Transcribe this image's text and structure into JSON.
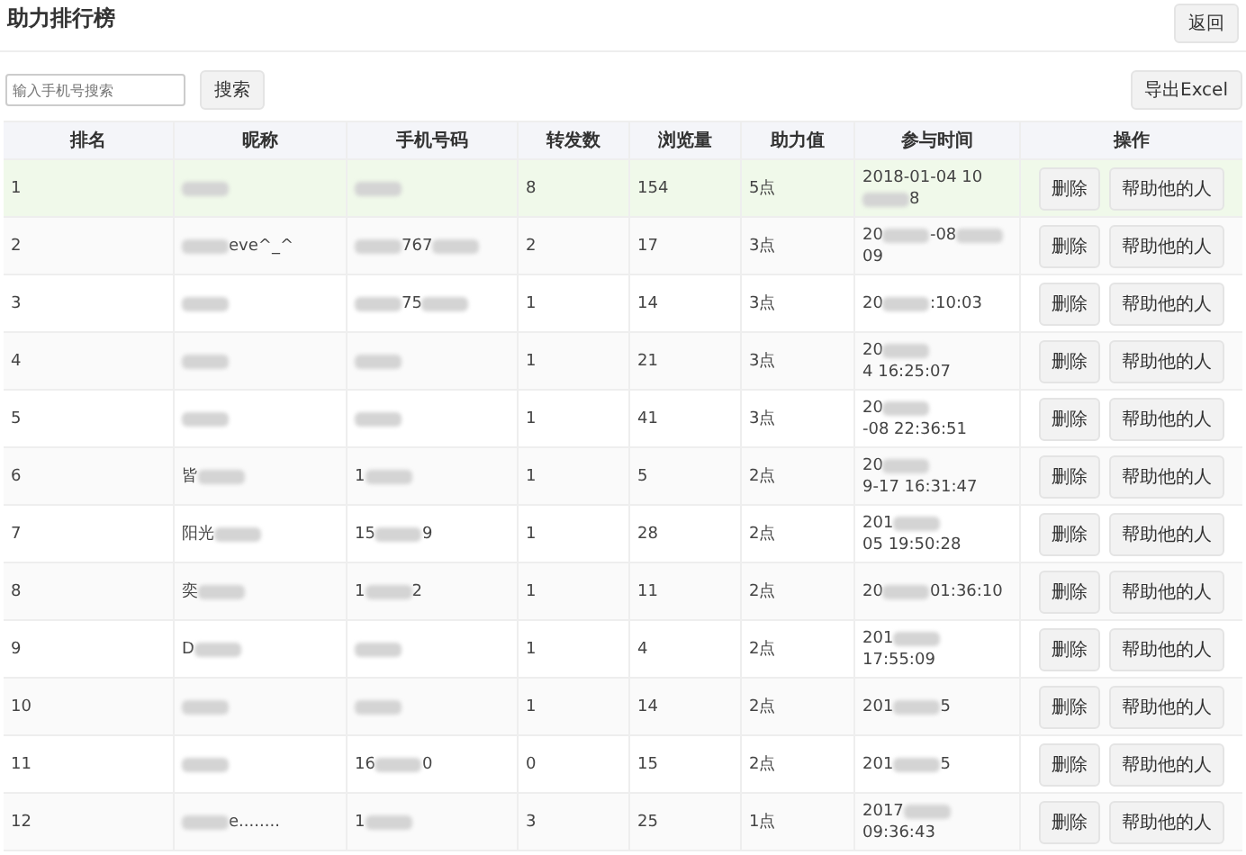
{
  "page": {
    "title": "助力排行榜",
    "back_button": "返回"
  },
  "toolbar": {
    "search": {
      "placeholder": "输入手机号搜索"
    },
    "search_button": "搜索",
    "export_button": "导出Excel"
  },
  "table": {
    "columns": [
      "排名",
      "昵称",
      "手机号码",
      "转发数",
      "浏览量",
      "助力值",
      "参与时间",
      "操作"
    ],
    "rows": [
      {
        "selected": true,
        "rank": "1",
        "actions": [
          "删除",
          "帮助他的人"
        ],
        "nickname": [
          {
            "kind": "blur"
          }
        ],
        "phone": [
          {
            "kind": "blur"
          }
        ],
        "shares": "8",
        "views": "154",
        "points": "5点",
        "time": [
          {
            "kind": "text",
            "text": "2018-01-04 10"
          },
          {
            "kind": "blur"
          },
          {
            "kind": "text",
            "text": "8"
          }
        ]
      },
      {
        "selected": false,
        "rank": "2",
        "actions": [
          "删除",
          "帮助他的人"
        ],
        "nickname": [
          {
            "kind": "blur"
          },
          {
            "kind": "text",
            "text": "eve^_^"
          }
        ],
        "phone": [
          {
            "kind": "blur"
          },
          {
            "kind": "text",
            "text": "767"
          },
          {
            "kind": "blur"
          }
        ],
        "shares": "2",
        "views": "17",
        "points": "3点",
        "time": [
          {
            "kind": "text",
            "text": "20"
          },
          {
            "kind": "blur"
          },
          {
            "kind": "text",
            "text": "-08"
          },
          {
            "kind": "blur"
          },
          {
            "kind": "text",
            "text": "09"
          }
        ]
      },
      {
        "selected": false,
        "rank": "3",
        "actions": [
          "删除",
          "帮助他的人"
        ],
        "nickname": [
          {
            "kind": "blur"
          }
        ],
        "phone": [
          {
            "kind": "blur"
          },
          {
            "kind": "text",
            "text": "75"
          },
          {
            "kind": "blur"
          }
        ],
        "shares": "1",
        "views": "14",
        "points": "3点",
        "time": [
          {
            "kind": "text",
            "text": "20"
          },
          {
            "kind": "blur"
          },
          {
            "kind": "text",
            "text": ":10:03"
          }
        ]
      },
      {
        "selected": false,
        "rank": "4",
        "actions": [
          "删除",
          "帮助他的人"
        ],
        "nickname": [
          {
            "kind": "blur"
          }
        ],
        "phone": [
          {
            "kind": "blur"
          }
        ],
        "shares": "1",
        "views": "21",
        "points": "3点",
        "time": [
          {
            "kind": "text",
            "text": "20"
          },
          {
            "kind": "blur"
          },
          {
            "kind": "text",
            "text": "4 16:25:07"
          }
        ]
      },
      {
        "selected": false,
        "rank": "5",
        "actions": [
          "删除",
          "帮助他的人"
        ],
        "nickname": [
          {
            "kind": "blur"
          }
        ],
        "phone": [
          {
            "kind": "blur"
          }
        ],
        "shares": "1",
        "views": "41",
        "points": "3点",
        "time": [
          {
            "kind": "text",
            "text": "20"
          },
          {
            "kind": "blur"
          },
          {
            "kind": "text",
            "text": "-08 22:36:51"
          }
        ]
      },
      {
        "selected": false,
        "rank": "6",
        "actions": [
          "删除",
          "帮助他的人"
        ],
        "nickname": [
          {
            "kind": "text",
            "text": "皆"
          },
          {
            "kind": "blur"
          }
        ],
        "phone": [
          {
            "kind": "text",
            "text": "1"
          },
          {
            "kind": "blur"
          }
        ],
        "shares": "1",
        "views": "5",
        "points": "2点",
        "time": [
          {
            "kind": "text",
            "text": "20"
          },
          {
            "kind": "blur"
          },
          {
            "kind": "text",
            "text": "9-17 16:31:47"
          }
        ]
      },
      {
        "selected": false,
        "rank": "7",
        "actions": [
          "删除",
          "帮助他的人"
        ],
        "nickname": [
          {
            "kind": "text",
            "text": "阳光"
          },
          {
            "kind": "blur"
          }
        ],
        "phone": [
          {
            "kind": "text",
            "text": "15"
          },
          {
            "kind": "blur"
          },
          {
            "kind": "text",
            "text": "9"
          }
        ],
        "shares": "1",
        "views": "28",
        "points": "2点",
        "time": [
          {
            "kind": "text",
            "text": "201"
          },
          {
            "kind": "blur"
          },
          {
            "kind": "text",
            "text": "05 19:50:28"
          }
        ]
      },
      {
        "selected": false,
        "rank": "8",
        "actions": [
          "删除",
          "帮助他的人"
        ],
        "nickname": [
          {
            "kind": "text",
            "text": "奕"
          },
          {
            "kind": "blur"
          }
        ],
        "phone": [
          {
            "kind": "text",
            "text": "1"
          },
          {
            "kind": "blur"
          },
          {
            "kind": "text",
            "text": "2"
          }
        ],
        "shares": "1",
        "views": "11",
        "points": "2点",
        "time": [
          {
            "kind": "text",
            "text": "20"
          },
          {
            "kind": "blur"
          },
          {
            "kind": "text",
            "text": "01:36:10"
          }
        ]
      },
      {
        "selected": false,
        "rank": "9",
        "actions": [
          "删除",
          "帮助他的人"
        ],
        "nickname": [
          {
            "kind": "text",
            "text": "D"
          },
          {
            "kind": "blur"
          }
        ],
        "phone": [
          {
            "kind": "blur"
          }
        ],
        "shares": "1",
        "views": "4",
        "points": "2点",
        "time": [
          {
            "kind": "text",
            "text": "201"
          },
          {
            "kind": "blur"
          },
          {
            "kind": "text",
            "text": "17:55:09"
          }
        ]
      },
      {
        "selected": false,
        "rank": "10",
        "actions": [
          "删除",
          "帮助他的人"
        ],
        "nickname": [
          {
            "kind": "blur"
          }
        ],
        "phone": [
          {
            "kind": "blur"
          }
        ],
        "shares": "1",
        "views": "14",
        "points": "2点",
        "time": [
          {
            "kind": "text",
            "text": "201"
          },
          {
            "kind": "blur"
          },
          {
            "kind": "text",
            "text": "5"
          }
        ]
      },
      {
        "selected": false,
        "rank": "11",
        "actions": [
          "删除",
          "帮助他的人"
        ],
        "nickname": [
          {
            "kind": "blur"
          }
        ],
        "phone": [
          {
            "kind": "text",
            "text": "16"
          },
          {
            "kind": "blur"
          },
          {
            "kind": "text",
            "text": "0"
          }
        ],
        "shares": "0",
        "views": "15",
        "points": "2点",
        "time": [
          {
            "kind": "text",
            "text": "201"
          },
          {
            "kind": "blur"
          },
          {
            "kind": "text",
            "text": "5"
          }
        ]
      },
      {
        "selected": false,
        "rank": "12",
        "actions": [
          "删除",
          "帮助他的人"
        ],
        "nickname": [
          {
            "kind": "blur"
          },
          {
            "kind": "text",
            "text": "e........"
          }
        ],
        "phone": [
          {
            "kind": "text",
            "text": "1"
          },
          {
            "kind": "blur"
          }
        ],
        "shares": "3",
        "views": "25",
        "points": "1点",
        "time": [
          {
            "kind": "text",
            "text": "2017"
          },
          {
            "kind": "blur"
          },
          {
            "kind": "text",
            "text": "09:36:43"
          }
        ]
      }
    ]
  }
}
